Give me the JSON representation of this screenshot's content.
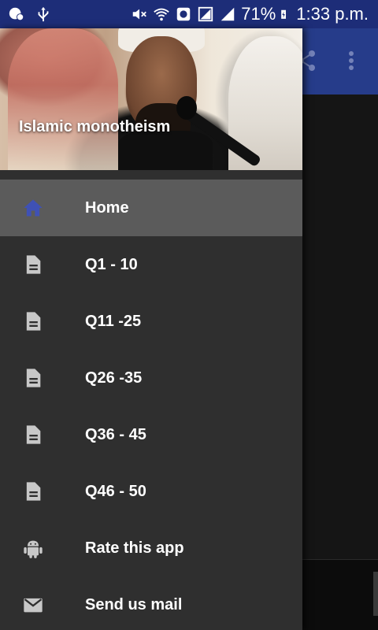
{
  "status_bar": {
    "battery": "71%",
    "time": "1:33 p.m."
  },
  "drawer": {
    "header_title": "Islamic monotheism",
    "items": [
      {
        "label": "Home",
        "icon": "home-icon",
        "active": true
      },
      {
        "label": "Q1 - 10",
        "icon": "document-icon"
      },
      {
        "label": "Q11 -25",
        "icon": "document-icon"
      },
      {
        "label": "Q26 -35",
        "icon": "document-icon"
      },
      {
        "label": "Q36 - 45",
        "icon": "document-icon"
      },
      {
        "label": "Q46 - 50",
        "icon": "document-icon"
      },
      {
        "label": "Rate this app",
        "icon": "android-icon"
      },
      {
        "label": "Send us mail",
        "icon": "mail-icon"
      }
    ]
  },
  "colors": {
    "status_bar": "#1d2d78",
    "app_bar": "#263c8a",
    "drawer_bg": "#2f2f2f",
    "active_item_bg": "#5b5b5b",
    "home_icon": "#3f51b5",
    "list_icon": "#c8c8c8"
  }
}
